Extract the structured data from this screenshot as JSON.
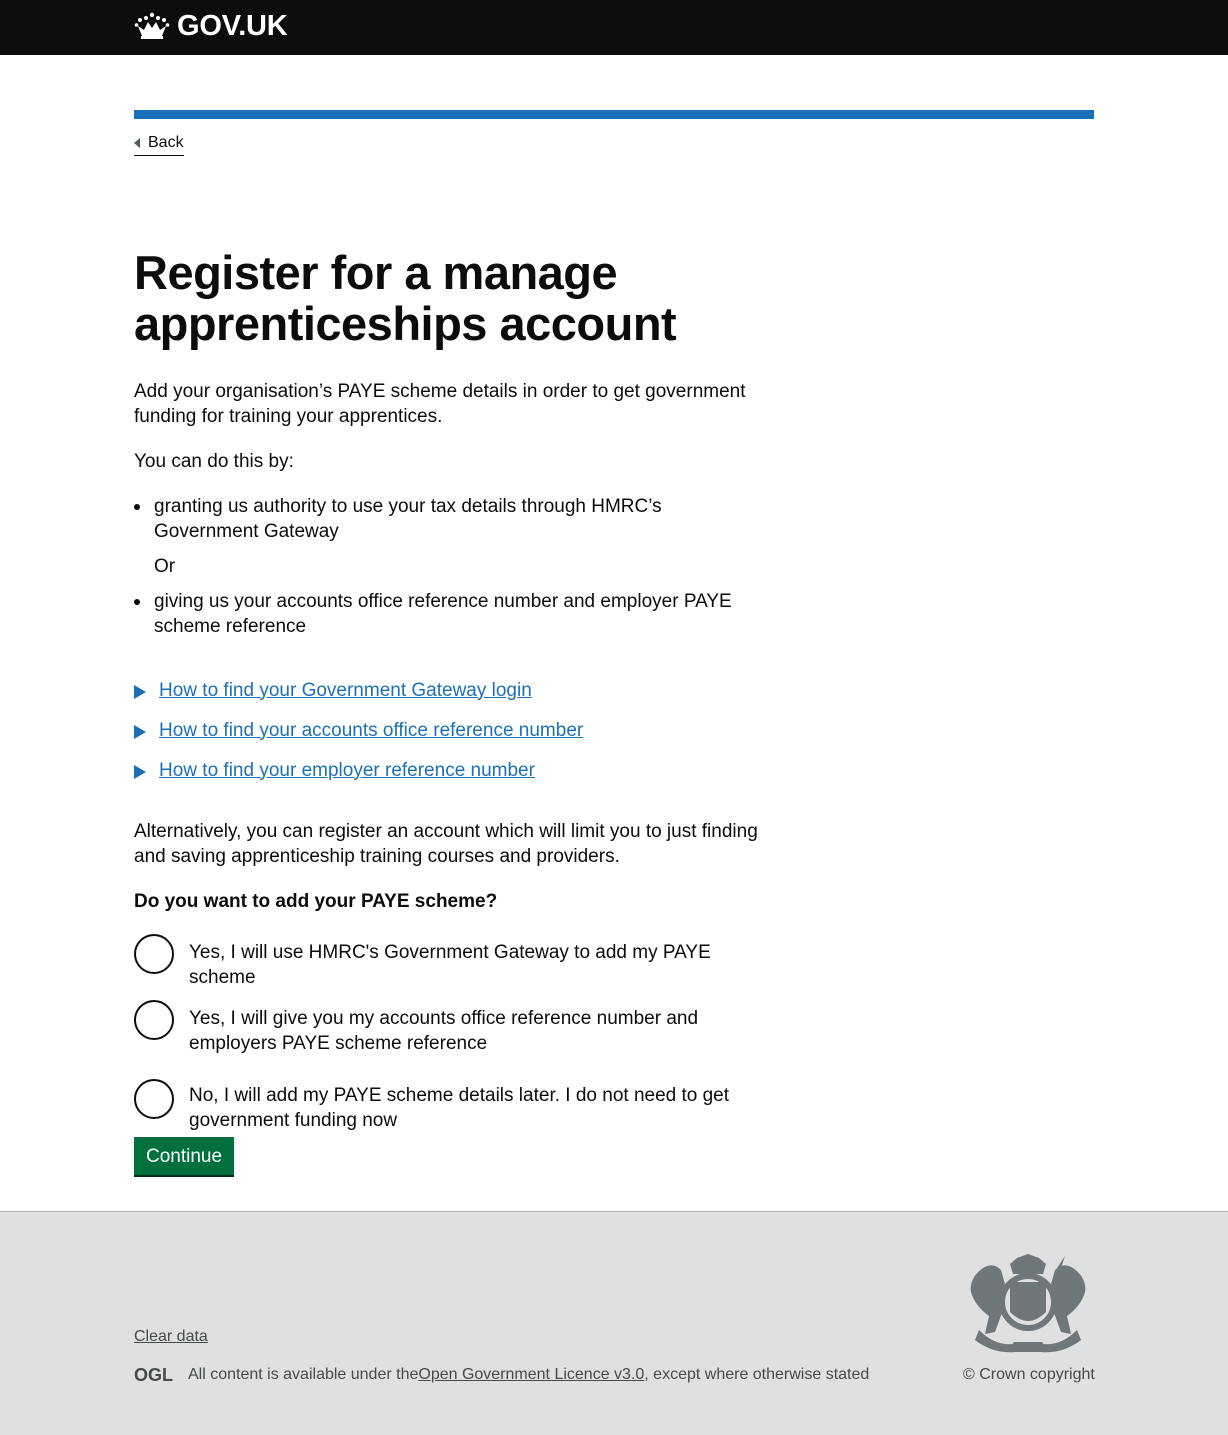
{
  "header": {
    "logo_text": "GOV.UK"
  },
  "back_link": "Back",
  "page_title": "Register for a manage apprenticeships account",
  "intro": "Add your organisation’s PAYE scheme details in order to get government funding for training your apprentices.",
  "can_do_by": "You can do this by:",
  "bullets": [
    "granting us authority to use your tax details through HMRC’s Government Gateway",
    "giving us your accounts office reference number and employer PAYE scheme reference"
  ],
  "or_text": "Or",
  "details": [
    "How to find your Government Gateway login",
    "How to find your accounts office reference number",
    "How to find your employer reference number"
  ],
  "alternative": "Alternatively, you can register an account which will limit you to just finding and saving apprenticeship training courses and providers.",
  "question": "Do you want to add your PAYE scheme?",
  "radios": [
    "Yes, I will use HMRC's Government Gateway to add my PAYE scheme",
    "Yes, I will give you my accounts office reference number and employers PAYE scheme reference",
    "No, I will add my PAYE scheme details later. I do not need to get government funding now"
  ],
  "continue_label": "Continue",
  "footer": {
    "clear_data": "Clear data",
    "licence_prefix": "All content is available under the ",
    "licence_link": "Open Government Licence v3.0",
    "licence_suffix": ", except where otherwise stated",
    "copyright": "© Crown copyright",
    "ogl_logo_text": "OGL"
  },
  "colors": {
    "header_bg": "#0b0c0c",
    "brand_blue": "#1d70b8",
    "button_green": "#00703c",
    "footer_bg": "#dee0e2"
  }
}
